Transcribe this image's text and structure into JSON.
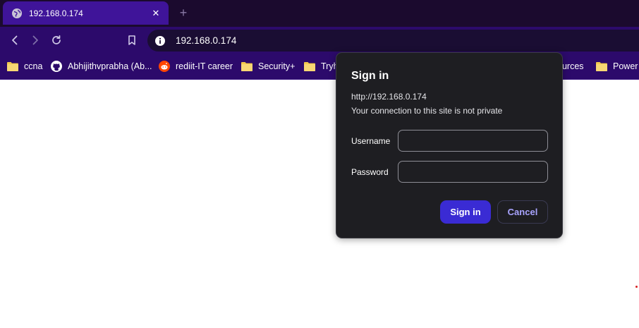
{
  "tab": {
    "title": "192.168.0.174",
    "close_glyph": "✕",
    "favicon": "globe-icon"
  },
  "new_tab_glyph": "+",
  "omnibox": {
    "url": "192.168.0.174",
    "icon": "info-icon"
  },
  "bookmarks": [
    {
      "label": "ccna",
      "icon": "folder-icon"
    },
    {
      "label": "Abhijithvprabha (Ab...",
      "icon": "github-icon"
    },
    {
      "label": "rediit-IT career",
      "icon": "reddit-icon"
    },
    {
      "label": "Security+",
      "icon": "folder-icon"
    },
    {
      "label": "Tryha",
      "icon": "folder-icon"
    },
    {
      "label": "ources",
      "icon": ""
    },
    {
      "label": "Power",
      "icon": "folder-icon"
    }
  ],
  "dialog": {
    "title": "Sign in",
    "origin": "http://192.168.0.174",
    "warning": "Your connection to this site is not private",
    "username_label": "Username",
    "password_label": "Password",
    "username_value": "",
    "password_value": "",
    "signin_label": "Sign in",
    "cancel_label": "Cancel"
  },
  "colors": {
    "tabstrip": "#1b0a2e",
    "active_tab": "#3f1499",
    "toolbar": "#2c0a6b",
    "dialog_bg": "#1e1e22",
    "primary_button": "#3a2bd4",
    "cancel_text": "#a9a4ff",
    "folder": "#f2c94c"
  }
}
